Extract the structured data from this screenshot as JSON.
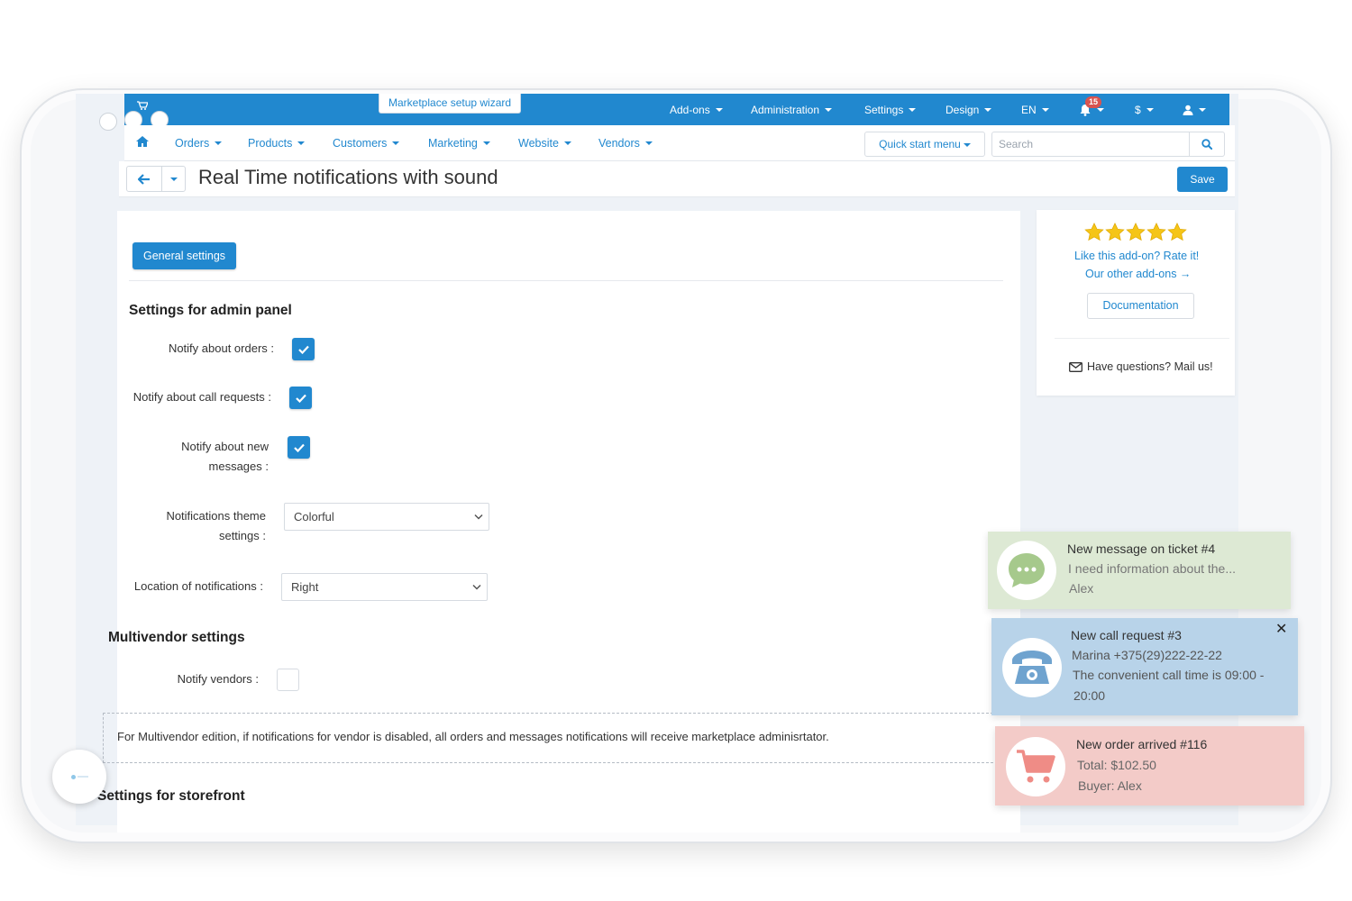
{
  "topbar": {
    "wizard_label": "Marketplace setup wizard",
    "menus": [
      "Add-ons",
      "Administration",
      "Settings",
      "Design",
      "EN"
    ],
    "notification_count": "15",
    "currency": "$",
    "brand_color": "#2188cf"
  },
  "nav": {
    "items": [
      "Orders",
      "Products",
      "Customers",
      "Marketing",
      "Website",
      "Vendors"
    ],
    "quick_start_label": "Quick start menu",
    "search_placeholder": "Search"
  },
  "page": {
    "title": "Real Time notifications with sound",
    "save_label": "Save"
  },
  "settings": {
    "tab_label": "General settings",
    "admin_heading": "Settings for admin panel",
    "notify_orders_label": "Notify about orders :",
    "notify_calls_label": "Notify about call requests :",
    "notify_messages_label_1": "Notify about new",
    "notify_messages_label_2": "messages :",
    "theme_label_1": "Notifications theme",
    "theme_label_2": "settings :",
    "theme_value": "Colorful",
    "location_label": "Location of notifications :",
    "location_value": "Right",
    "multivendor_heading": "Multivendor settings",
    "notify_vendors_label": "Notify vendors :",
    "note": "For Multivendor edition, if notifications for vendor is disabled, all orders and messages notifications will receive marketplace adminisrtator.",
    "storefront_heading": "Settings for storefront",
    "notify_orders": true,
    "notify_calls": true,
    "notify_messages": true,
    "notify_vendors": false
  },
  "sidebar": {
    "rating": 5,
    "rate_text": "Like this add-on? Rate it!",
    "other_addons": "Our other add-ons →",
    "documentation": "Documentation",
    "mail_text": "Have questions? Mail us!"
  },
  "notifications": [
    {
      "title": "New message on ticket #4",
      "line2": "I need information about the...",
      "line3": "Alex",
      "color": "#dde9d4"
    },
    {
      "title": "New call request #3",
      "line2": "Marina +375(29)222-22-22",
      "line3": "The convenient call time is 09:00 -",
      "line4": "20:00",
      "color": "#b8d3e9"
    },
    {
      "title": "New order arrived #116",
      "line2": "Total: $102.50",
      "line3": "Buyer: Alex",
      "color": "#f3cbc8"
    }
  ]
}
